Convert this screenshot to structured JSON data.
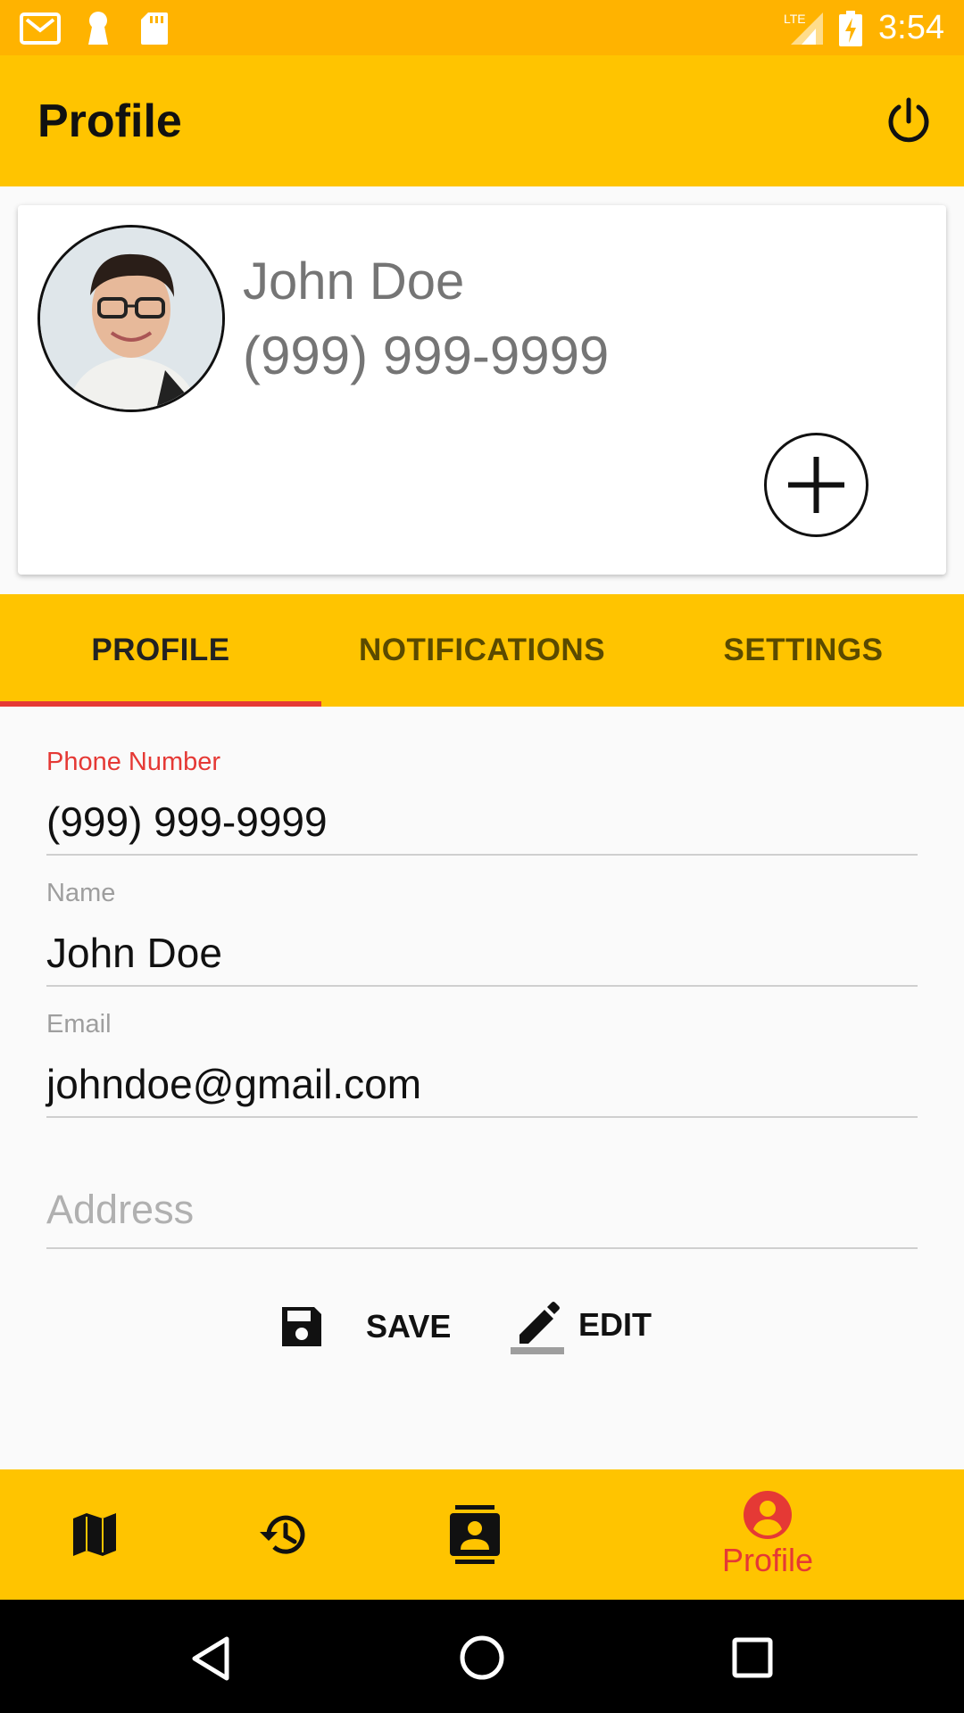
{
  "status_bar": {
    "time": "3:54",
    "left_icons": [
      "gmail-icon",
      "keyhole-icon",
      "sd-card-icon"
    ],
    "right_icons": [
      "lte-signal-icon",
      "battery-charging-icon"
    ]
  },
  "app_bar": {
    "title": "Profile",
    "power_icon": "power-icon"
  },
  "profile_card": {
    "name": "John Doe",
    "phone": "(999) 999-9999",
    "add_icon": "plus-icon"
  },
  "tabs": [
    {
      "label": "PROFILE",
      "selected": true
    },
    {
      "label": "NOTIFICATIONS",
      "selected": false
    },
    {
      "label": "SETTINGS",
      "selected": false
    }
  ],
  "form": {
    "phone": {
      "label": "Phone Number",
      "value": "(999) 999-9999"
    },
    "name": {
      "label": "Name",
      "value": "John Doe"
    },
    "email": {
      "label": "Email",
      "value": "johndoe@gmail.com"
    },
    "address": {
      "placeholder": "Address",
      "value": ""
    }
  },
  "actions": {
    "save_label": "SAVE",
    "edit_label": "EDIT"
  },
  "bottom_nav": {
    "items": [
      {
        "icon": "map-icon",
        "label": ""
      },
      {
        "icon": "history-icon",
        "label": ""
      },
      {
        "icon": "contacts-icon",
        "label": ""
      },
      {
        "icon": "account-circle-icon",
        "label": "Profile",
        "active": true
      }
    ]
  },
  "colors": {
    "status_bar": "#ffb300",
    "primary": "#ffc400",
    "accent": "#e53935"
  }
}
